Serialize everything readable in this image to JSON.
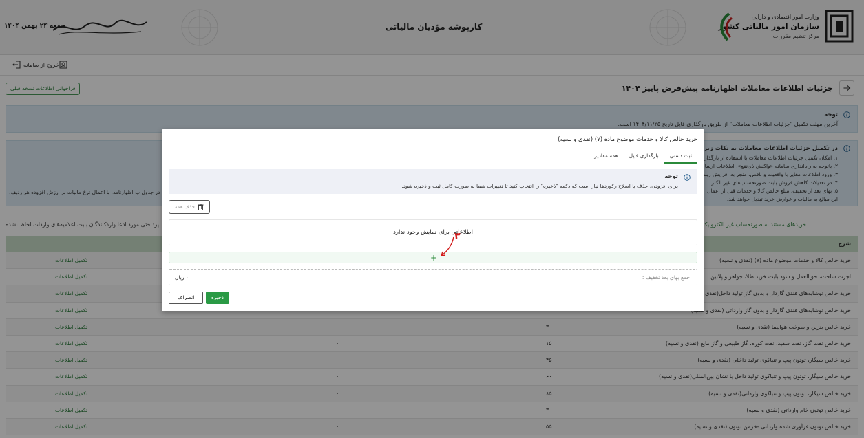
{
  "header": {
    "org_line1": "وزارت امور اقتصادی و دارایی",
    "org_line2": "سازمان امور مالیاتی کشور",
    "org_line3": "مرکز تنظیم مقررات",
    "title": "کارپوشه مؤدیان مالیاتی",
    "date": "جمعه ۲۴ بهمن ۱۴۰۴"
  },
  "exitbar": {
    "exit_label": "خروج از سامانه"
  },
  "page": {
    "title": "جزئیات اطلاعات معاملات اظهارنامه پیش‌فرض  پاییز ۱۴۰۴",
    "prev_button": "فراخوانی اطلاعات نسخه قبلی"
  },
  "notice1": {
    "title": "توجه",
    "body": "آخرین مهلت تکمیل \"جزئیات اطلاعات معاملات\" از طریق بارگذاری فایل تاریخ ۱۴۰۴/۱۱/۲۵ است."
  },
  "notice2": {
    "title": "در تکمیل جزئیات اطلاعات معاملات به نکات زیر توجه کنید",
    "lines": [
      "۱. امکان تکمیل جزئیات اطلاعات معاملات با استفاده از بارگذاری",
      "۲. باتوجه به راه‌اندازی سامانه «واکنش ذی‌نفع»، اطلاعات ارسال",
      "۳. ورود اطلاعات مغایر با واقعیت و ناقص، منجر به افزایش ریس",
      "۴. در تعدیلات کاهش فروش بابت صورتحساب‌های غیر الکتر",
      "۵. بهای بعد از تخفیف، مبلغ خالص کالا و خدمات قبل از اعمال",
      "این مبالغ به مالیات و عوارض خرید تبدیل خواهد شد."
    ],
    "left_line": "در جدول ب اظهارنامه، با اعمال نرخ مالیات بر ارزش افزوده هر ردیف،"
  },
  "tabs2": {
    "a": "خریدهای مستند به صورتحساب غیر الکترونیکی",
    "b": "پرداختی مورد ادعا واردکنندگان بابت اعلامیه‌های واردات لحاظ نشده"
  },
  "table": {
    "header": "شرح",
    "action_label": "تکمیل اطلاعات",
    "rows": [
      {
        "desc": "خرید خالص کالا و خدمات موضوع ماده (۷) (نقدی و نسیه)",
        "rate": "",
        "amount": ""
      },
      {
        "desc": "اجرت ساخت، حق‌العمل و سود بابت خرید طلا، جواهر و پلاتین",
        "rate": "",
        "amount": ""
      },
      {
        "desc": "خرید خالص نوشابه‌های قندی گازدار و بدون گاز تولید داخل(نقدی و نسیه)",
        "rate": "",
        "amount": ""
      },
      {
        "desc": "خرید خالص نوشابه‌های قندی گازدار و بدون گاز وارداتی (نقدی و نسیه)",
        "rate": "",
        "amount": ""
      },
      {
        "desc": "خرید خالص بنزین و سوخت هواپیما (نقدی و نسیه)",
        "rate": "۳۰",
        "amount": "۰"
      },
      {
        "desc": "خرید خالص نفت گاز، نفت سفید، نفت کوره، گاز طبیعی و گاز مایع (نقدی و نسیه)",
        "rate": "۱۵",
        "amount": "۰"
      },
      {
        "desc": "خرید خالص سیگار، توتون پیپ و تنباکوی تولید داخلی (نقدی و نسیه)",
        "rate": "۴۵",
        "amount": "۰"
      },
      {
        "desc": "خرید خالص سیگار، توتون پیپ و تنباکوی تولید داخل با نشان بین‌المللی(نقدی و  نسیه)",
        "rate": "۶۰",
        "amount": "۰"
      },
      {
        "desc": "خرید خالص سیگار، توتون پیپ و تنباکوی وارداتی(نقدی و  نسیه)",
        "rate": "۸۵",
        "amount": "۰"
      },
      {
        "desc": "خرید خالص توتون خام وارداتی  (نقدی و  نسیه)",
        "rate": "۳۰",
        "amount": "۰"
      },
      {
        "desc": "خرید خالص توتون فرآوری شده وارداتی -خرمن توتون (نقدی و  نسیه)",
        "rate": "۵۵",
        "amount": "۰"
      }
    ]
  },
  "modal": {
    "title": "خرید خالص کالا و خدمات موضوع ماده (۷) (نقدی و نسیه)",
    "tabs": [
      "ثبت دستی",
      "بارگذاری فایل",
      "همه مقادیر"
    ],
    "notice_title": "توجه",
    "notice_body": "برای افزودن، حذف یا اصلاح رکوردها نیاز است که دکمه \"ذخیره\" را انتخاب کنید تا تغییرات شما به صورت کامل ثبت و ذخیره شود.",
    "delete_all": "حذف همه",
    "empty_message": "اطلاعاتی برای نمایش وجود ندارد",
    "add_symbol": "+",
    "sum_label": "جمع بهای بعد تخفیف :",
    "sum_value": "۰ ریال",
    "save": "ذخیره",
    "cancel": "انصراف",
    "annotation_number": "۳"
  },
  "colors": {
    "accent": "#2a9a45",
    "notice_bg": "#dcebf4",
    "table_header": "#c9dcc9",
    "annotation": "#d21c1c"
  }
}
